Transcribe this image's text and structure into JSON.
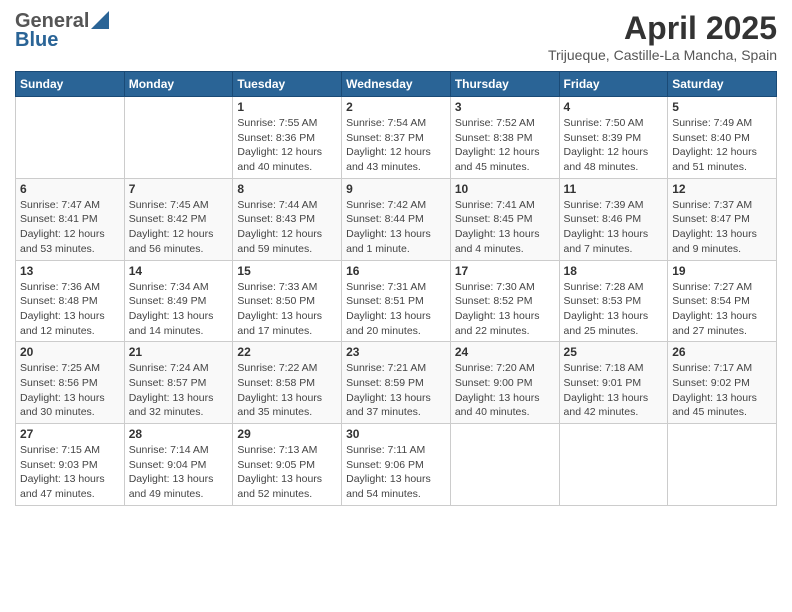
{
  "header": {
    "logo_general": "General",
    "logo_blue": "Blue",
    "title": "April 2025",
    "location": "Trijueque, Castille-La Mancha, Spain"
  },
  "days_of_week": [
    "Sunday",
    "Monday",
    "Tuesday",
    "Wednesday",
    "Thursday",
    "Friday",
    "Saturday"
  ],
  "weeks": [
    [
      {
        "day": "",
        "sunrise": "",
        "sunset": "",
        "daylight": ""
      },
      {
        "day": "",
        "sunrise": "",
        "sunset": "",
        "daylight": ""
      },
      {
        "day": "1",
        "sunrise": "Sunrise: 7:55 AM",
        "sunset": "Sunset: 8:36 PM",
        "daylight": "Daylight: 12 hours and 40 minutes."
      },
      {
        "day": "2",
        "sunrise": "Sunrise: 7:54 AM",
        "sunset": "Sunset: 8:37 PM",
        "daylight": "Daylight: 12 hours and 43 minutes."
      },
      {
        "day": "3",
        "sunrise": "Sunrise: 7:52 AM",
        "sunset": "Sunset: 8:38 PM",
        "daylight": "Daylight: 12 hours and 45 minutes."
      },
      {
        "day": "4",
        "sunrise": "Sunrise: 7:50 AM",
        "sunset": "Sunset: 8:39 PM",
        "daylight": "Daylight: 12 hours and 48 minutes."
      },
      {
        "day": "5",
        "sunrise": "Sunrise: 7:49 AM",
        "sunset": "Sunset: 8:40 PM",
        "daylight": "Daylight: 12 hours and 51 minutes."
      }
    ],
    [
      {
        "day": "6",
        "sunrise": "Sunrise: 7:47 AM",
        "sunset": "Sunset: 8:41 PM",
        "daylight": "Daylight: 12 hours and 53 minutes."
      },
      {
        "day": "7",
        "sunrise": "Sunrise: 7:45 AM",
        "sunset": "Sunset: 8:42 PM",
        "daylight": "Daylight: 12 hours and 56 minutes."
      },
      {
        "day": "8",
        "sunrise": "Sunrise: 7:44 AM",
        "sunset": "Sunset: 8:43 PM",
        "daylight": "Daylight: 12 hours and 59 minutes."
      },
      {
        "day": "9",
        "sunrise": "Sunrise: 7:42 AM",
        "sunset": "Sunset: 8:44 PM",
        "daylight": "Daylight: 13 hours and 1 minute."
      },
      {
        "day": "10",
        "sunrise": "Sunrise: 7:41 AM",
        "sunset": "Sunset: 8:45 PM",
        "daylight": "Daylight: 13 hours and 4 minutes."
      },
      {
        "day": "11",
        "sunrise": "Sunrise: 7:39 AM",
        "sunset": "Sunset: 8:46 PM",
        "daylight": "Daylight: 13 hours and 7 minutes."
      },
      {
        "day": "12",
        "sunrise": "Sunrise: 7:37 AM",
        "sunset": "Sunset: 8:47 PM",
        "daylight": "Daylight: 13 hours and 9 minutes."
      }
    ],
    [
      {
        "day": "13",
        "sunrise": "Sunrise: 7:36 AM",
        "sunset": "Sunset: 8:48 PM",
        "daylight": "Daylight: 13 hours and 12 minutes."
      },
      {
        "day": "14",
        "sunrise": "Sunrise: 7:34 AM",
        "sunset": "Sunset: 8:49 PM",
        "daylight": "Daylight: 13 hours and 14 minutes."
      },
      {
        "day": "15",
        "sunrise": "Sunrise: 7:33 AM",
        "sunset": "Sunset: 8:50 PM",
        "daylight": "Daylight: 13 hours and 17 minutes."
      },
      {
        "day": "16",
        "sunrise": "Sunrise: 7:31 AM",
        "sunset": "Sunset: 8:51 PM",
        "daylight": "Daylight: 13 hours and 20 minutes."
      },
      {
        "day": "17",
        "sunrise": "Sunrise: 7:30 AM",
        "sunset": "Sunset: 8:52 PM",
        "daylight": "Daylight: 13 hours and 22 minutes."
      },
      {
        "day": "18",
        "sunrise": "Sunrise: 7:28 AM",
        "sunset": "Sunset: 8:53 PM",
        "daylight": "Daylight: 13 hours and 25 minutes."
      },
      {
        "day": "19",
        "sunrise": "Sunrise: 7:27 AM",
        "sunset": "Sunset: 8:54 PM",
        "daylight": "Daylight: 13 hours and 27 minutes."
      }
    ],
    [
      {
        "day": "20",
        "sunrise": "Sunrise: 7:25 AM",
        "sunset": "Sunset: 8:56 PM",
        "daylight": "Daylight: 13 hours and 30 minutes."
      },
      {
        "day": "21",
        "sunrise": "Sunrise: 7:24 AM",
        "sunset": "Sunset: 8:57 PM",
        "daylight": "Daylight: 13 hours and 32 minutes."
      },
      {
        "day": "22",
        "sunrise": "Sunrise: 7:22 AM",
        "sunset": "Sunset: 8:58 PM",
        "daylight": "Daylight: 13 hours and 35 minutes."
      },
      {
        "day": "23",
        "sunrise": "Sunrise: 7:21 AM",
        "sunset": "Sunset: 8:59 PM",
        "daylight": "Daylight: 13 hours and 37 minutes."
      },
      {
        "day": "24",
        "sunrise": "Sunrise: 7:20 AM",
        "sunset": "Sunset: 9:00 PM",
        "daylight": "Daylight: 13 hours and 40 minutes."
      },
      {
        "day": "25",
        "sunrise": "Sunrise: 7:18 AM",
        "sunset": "Sunset: 9:01 PM",
        "daylight": "Daylight: 13 hours and 42 minutes."
      },
      {
        "day": "26",
        "sunrise": "Sunrise: 7:17 AM",
        "sunset": "Sunset: 9:02 PM",
        "daylight": "Daylight: 13 hours and 45 minutes."
      }
    ],
    [
      {
        "day": "27",
        "sunrise": "Sunrise: 7:15 AM",
        "sunset": "Sunset: 9:03 PM",
        "daylight": "Daylight: 13 hours and 47 minutes."
      },
      {
        "day": "28",
        "sunrise": "Sunrise: 7:14 AM",
        "sunset": "Sunset: 9:04 PM",
        "daylight": "Daylight: 13 hours and 49 minutes."
      },
      {
        "day": "29",
        "sunrise": "Sunrise: 7:13 AM",
        "sunset": "Sunset: 9:05 PM",
        "daylight": "Daylight: 13 hours and 52 minutes."
      },
      {
        "day": "30",
        "sunrise": "Sunrise: 7:11 AM",
        "sunset": "Sunset: 9:06 PM",
        "daylight": "Daylight: 13 hours and 54 minutes."
      },
      {
        "day": "",
        "sunrise": "",
        "sunset": "",
        "daylight": ""
      },
      {
        "day": "",
        "sunrise": "",
        "sunset": "",
        "daylight": ""
      },
      {
        "day": "",
        "sunrise": "",
        "sunset": "",
        "daylight": ""
      }
    ]
  ]
}
